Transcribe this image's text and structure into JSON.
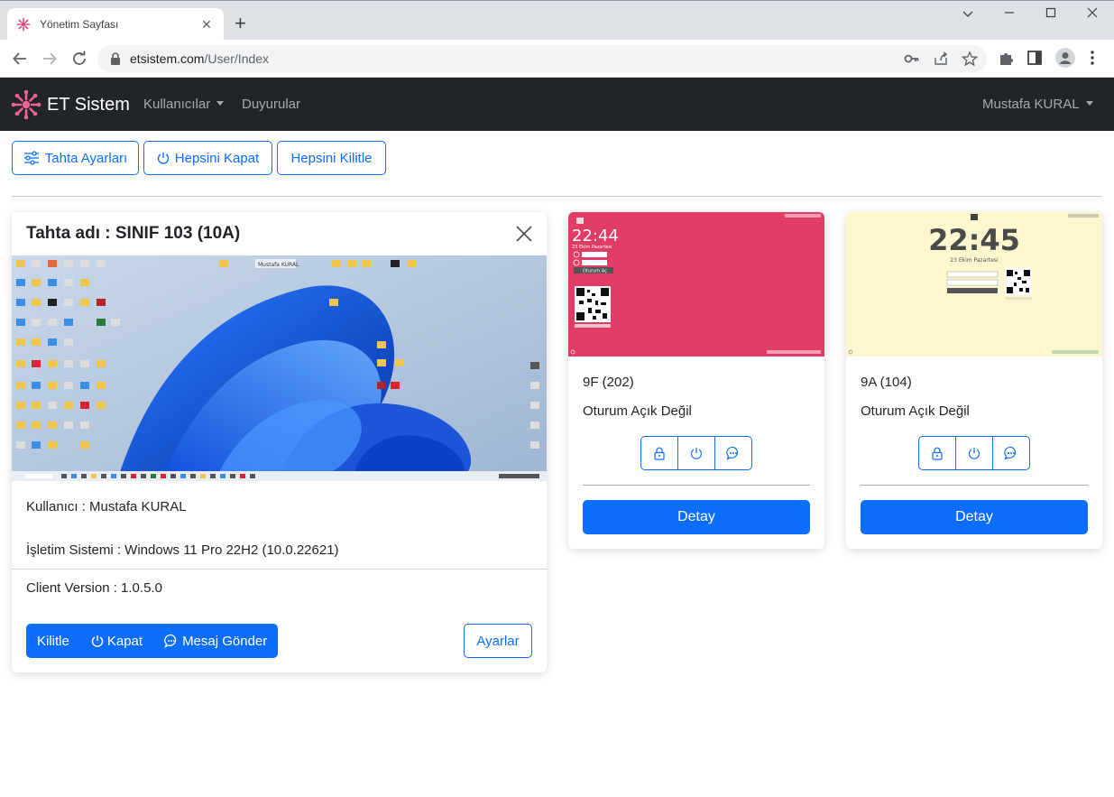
{
  "browser": {
    "tab_title": "Yönetim Sayfası",
    "url_host": "etsistem.com",
    "url_path": "/User/Index"
  },
  "navbar": {
    "brand": "ET Sistem",
    "links": [
      {
        "label": "Kullanıcılar"
      },
      {
        "label": "Duyurular"
      }
    ],
    "user": "Mustafa KURAL"
  },
  "toolbar": {
    "board_settings": "Tahta Ayarları",
    "close_all": "Hepsini Kapat",
    "lock_all": "Hepsini Kilitle"
  },
  "main_card": {
    "title": "Tahta adı : SINIF 103 (10A)",
    "user_line": "Kullanıcı : Mustafa KURAL",
    "os_line": "İşletim Sistemi : Windows 11 Pro 22H2 (10.0.22621)",
    "client_line": "Client Version : 1.0.5.0",
    "lock": "Kilitle",
    "shutdown": "Kapat",
    "message": "Mesaj Gönder",
    "settings": "Ayarlar",
    "screenshot_caption": "Mustafa KURAL"
  },
  "boards": [
    {
      "name": "9F (202)",
      "status": "Oturum Açık Değil",
      "detail": "Detay",
      "screen_time": "22:44",
      "screen_date": "23 Ekim Pazartesi",
      "screen_button": "Oturum Aç",
      "theme_color": "#e03c64"
    },
    {
      "name": "9A (104)",
      "status": "Oturum Açık Değil",
      "detail": "Detay",
      "screen_time": "22:45",
      "screen_date": "23 Ekim Pazartesi",
      "theme_color": "#fdf6cf"
    }
  ],
  "colors": {
    "primary": "#0d6efd",
    "navbar": "#212529",
    "brand_icon": "#f06292"
  }
}
